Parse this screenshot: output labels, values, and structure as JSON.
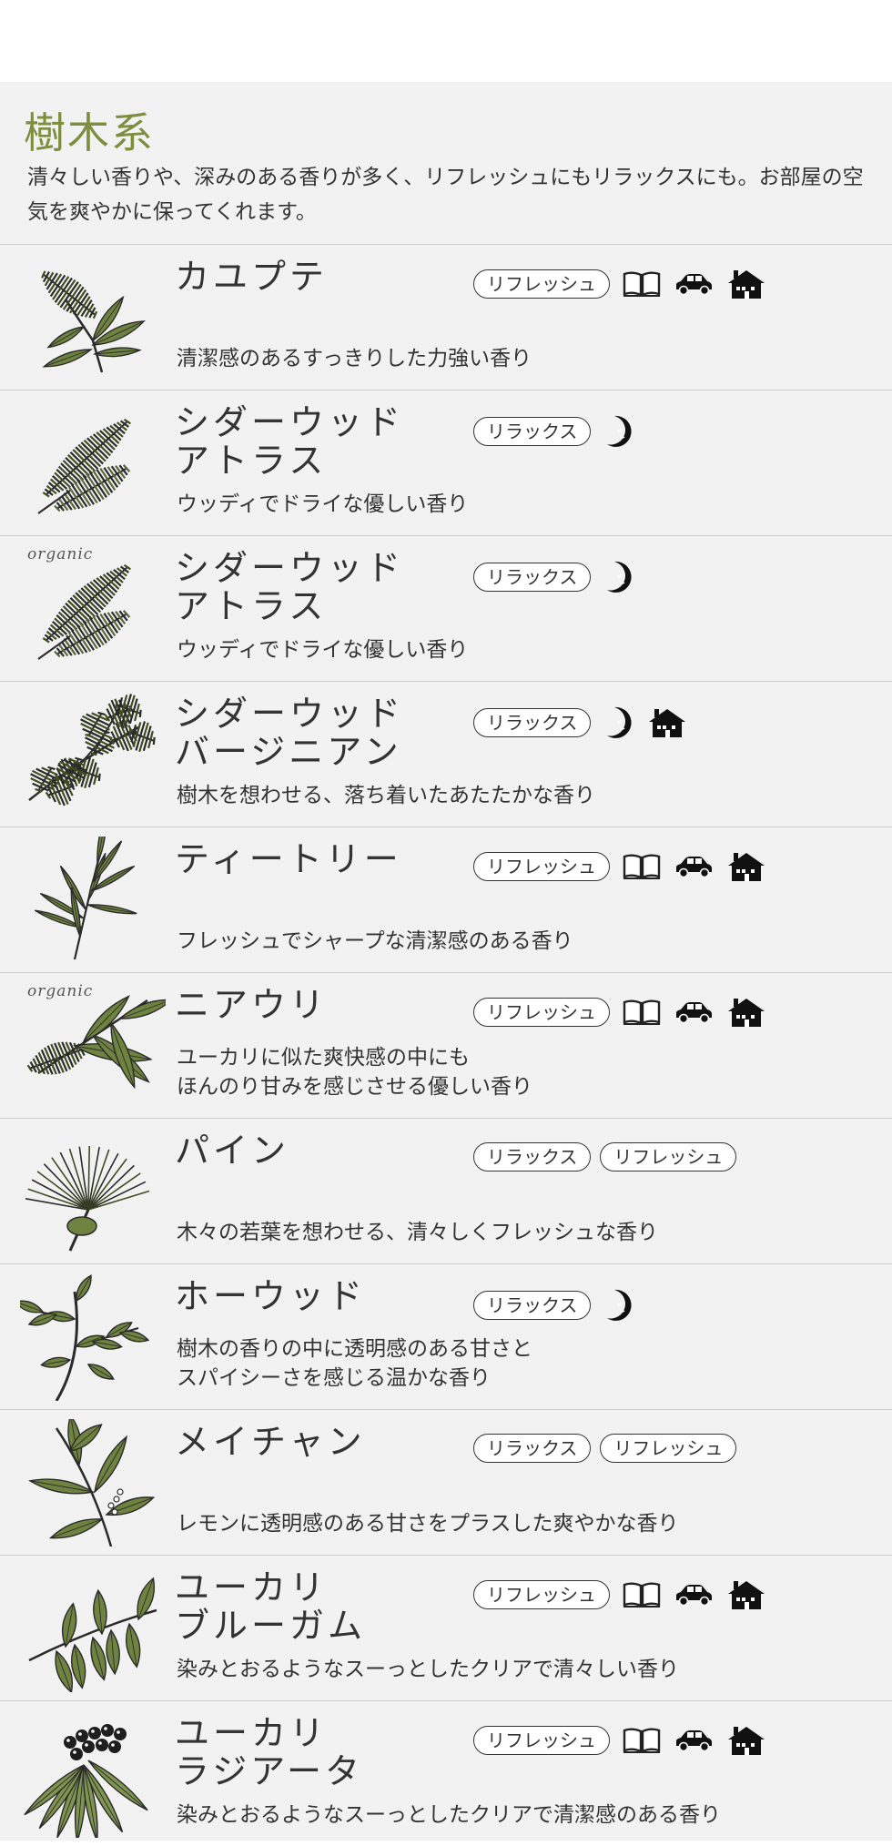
{
  "section": {
    "title": "樹木系",
    "description": "清々しい香りや、深みのある香りが多く、リフレッシュにもリラックスにも。お部屋の空気を爽やかに保ってくれます。"
  },
  "colors": {
    "accent": "#7d8f3f",
    "leaf": "#6f8340",
    "leaf_dark": "#3f4d1f"
  },
  "items": [
    {
      "illus": "bottlebrush",
      "organic": "",
      "name_lines": [
        "カユプテ"
      ],
      "tags": [
        "リフレッシュ"
      ],
      "icons": [
        "book-icon",
        "car-icon",
        "house-icon"
      ],
      "desc_lines": [
        "清潔感のあるすっきりした力強い香り"
      ]
    },
    {
      "illus": "cedar-brush",
      "organic": "",
      "name_lines": [
        "シダーウッド",
        "アトラス"
      ],
      "tags": [
        "リラックス"
      ],
      "icons": [
        "moon-icon"
      ],
      "desc_lines": [
        "ウッディでドライな優しい香り"
      ]
    },
    {
      "illus": "cedar-brush",
      "organic": "organic",
      "name_lines": [
        "シダーウッド",
        "アトラス"
      ],
      "tags": [
        "リラックス"
      ],
      "icons": [
        "moon-icon"
      ],
      "desc_lines": [
        "ウッディでドライな優しい香り"
      ]
    },
    {
      "illus": "juniper",
      "organic": "",
      "name_lines": [
        "シダーウッド",
        "バージニアン"
      ],
      "tags": [
        "リラックス"
      ],
      "icons": [
        "moon-icon",
        "house-icon"
      ],
      "desc_lines": [
        "樹木を想わせる、落ち着いたあたたかな香り"
      ]
    },
    {
      "illus": "narrow-leaf",
      "organic": "",
      "name_lines": [
        "ティートリー"
      ],
      "tags": [
        "リフレッシュ"
      ],
      "icons": [
        "book-icon",
        "car-icon",
        "house-icon"
      ],
      "desc_lines": [
        "フレッシュでシャープな清潔感のある香り"
      ]
    },
    {
      "illus": "broad-leaf",
      "organic": "organic",
      "name_lines": [
        "ニアウリ"
      ],
      "tags": [
        "リフレッシュ"
      ],
      "icons": [
        "book-icon",
        "car-icon",
        "house-icon"
      ],
      "desc_lines": [
        "ユーカリに似た爽快感の中にも",
        "ほんのり甘みを感じさせる優しい香り"
      ]
    },
    {
      "illus": "pine",
      "organic": "",
      "name_lines": [
        "パイン"
      ],
      "tags": [
        "リラックス",
        "リフレッシュ"
      ],
      "icons": [],
      "desc_lines": [
        "木々の若葉を想わせる、清々しくフレッシュな香り"
      ]
    },
    {
      "illus": "oval-leaf",
      "organic": "",
      "name_lines": [
        "ホーウッド"
      ],
      "tags": [
        "リラックス"
      ],
      "icons": [
        "moon-icon"
      ],
      "desc_lines": [
        "樹木の香りの中に透明感のある甘さと",
        "スパイシーさを感じる温かな香り"
      ]
    },
    {
      "illus": "long-leaf",
      "organic": "",
      "name_lines": [
        "メイチャン"
      ],
      "tags": [
        "リラックス",
        "リフレッシュ"
      ],
      "icons": [],
      "desc_lines": [
        "レモンに透明感のある甘さをプラスした爽やかな香り"
      ]
    },
    {
      "illus": "round-leaf",
      "organic": "",
      "name_lines": [
        "ユーカリ",
        "ブルーガム"
      ],
      "tags": [
        "リフレッシュ"
      ],
      "icons": [
        "book-icon",
        "car-icon",
        "house-icon"
      ],
      "desc_lines": [
        "染みとおるようなスーっとしたクリアで清々しい香り"
      ]
    },
    {
      "illus": "berry",
      "organic": "",
      "name_lines": [
        "ユーカリ",
        "ラジアータ"
      ],
      "tags": [
        "リフレッシュ"
      ],
      "icons": [
        "book-icon",
        "car-icon",
        "house-icon"
      ],
      "desc_lines": [
        "染みとおるようなスーっとしたクリアで清潔感のある香り"
      ]
    }
  ]
}
